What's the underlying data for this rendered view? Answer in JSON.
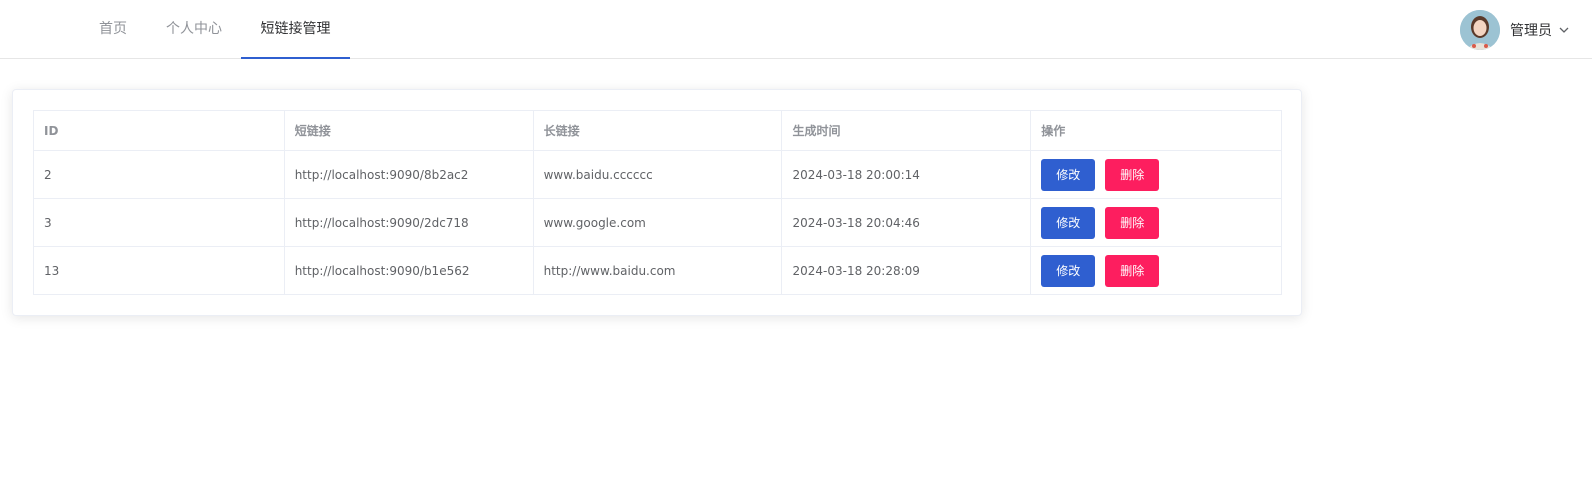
{
  "nav": {
    "items": [
      {
        "label": "首页"
      },
      {
        "label": "个人中心"
      },
      {
        "label": "短链接管理"
      }
    ],
    "active_index": 2,
    "accent_color": "#2f5fd0"
  },
  "user": {
    "name": "管理员",
    "dropdown_icon": "chevron-down-icon"
  },
  "table": {
    "headers": [
      "ID",
      "短链接",
      "长链接",
      "生成时间",
      "操作"
    ],
    "rows": [
      {
        "id": "2",
        "short": "http://localhost:9090/8b2ac2",
        "long": "www.baidu.cccccc",
        "time": "2024-03-18 20:00:14",
        "edit": "修改",
        "delete": "删除"
      },
      {
        "id": "3",
        "short": "http://localhost:9090/2dc718",
        "long": "www.google.com",
        "time": "2024-03-18 20:04:46",
        "edit": "修改",
        "delete": "删除"
      },
      {
        "id": "13",
        "short": "http://localhost:9090/b1e562",
        "long": "http://www.baidu.com",
        "time": "2024-03-18 20:28:09",
        "edit": "修改",
        "delete": "删除"
      }
    ]
  },
  "colors": {
    "edit_button": "#2f5fd0",
    "delete_button": "#fd1e5f"
  }
}
